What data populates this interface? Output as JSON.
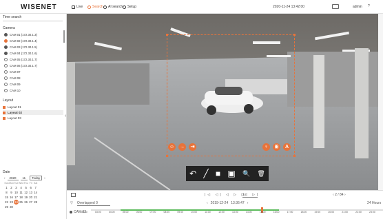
{
  "app": {
    "logo": "WISENET",
    "menu": [
      "Live",
      "Search",
      "AI search",
      "Setup"
    ],
    "datetime": "2020-11-24 13:42:00",
    "user": "admin"
  },
  "sidebar": {
    "search_label": "Time search",
    "camera_label": "Camera",
    "cameras": [
      "CAM 01 (172.30.1.3)",
      "CAM 02 (172.30.1.4)",
      "CAM 03 (172.30.1.5)",
      "CAM 04 (172.30.1.6)",
      "CAM 05 (172.30.1.7)",
      "CAM 06 (172.30.1.7)",
      "CAM 07",
      "CAM 08",
      "CAM 09",
      "CAM 10"
    ],
    "layout_label": "Layout",
    "layouts": [
      "Layout 01",
      "Layout 02",
      "Layout 03"
    ],
    "date_label": "Date",
    "year": "2020",
    "month": "11",
    "today": "Today",
    "weekdays": [
      "Sun",
      "Mon",
      "Tue",
      "Wed",
      "Thu",
      "Fri",
      "Sat"
    ],
    "weeks": [
      [
        "1",
        "2",
        "3",
        "4",
        "5",
        "6",
        "7"
      ],
      [
        "8",
        "9",
        "10",
        "11",
        "12",
        "13",
        "14"
      ],
      [
        "15",
        "16",
        "17",
        "18",
        "19",
        "20",
        "21"
      ],
      [
        "22",
        "23",
        "24",
        "25",
        "26",
        "27",
        "28"
      ],
      [
        "29",
        "30",
        "",
        "",
        "",
        "",
        ""
      ]
    ]
  },
  "overlay": {
    "tools": [
      "↶",
      "╱",
      "■",
      "▣",
      "🔍",
      "🗑"
    ]
  },
  "playback": {
    "filter": "Overlapped 0",
    "date": "2019-12-24",
    "time": "13:36:47",
    "speed": "1x",
    "page": "2",
    "total": "84",
    "range": "24 Hours",
    "cam": "CAM 02",
    "hours": [
      "02:00",
      "03:00",
      "04:00",
      "05:00",
      "06:00",
      "07:00",
      "08:00",
      "09:00",
      "10:00",
      "11:00",
      "12:00",
      "13:00",
      "14:00",
      "15:00",
      "16:00",
      "17:00",
      "18:00",
      "19:00",
      "20:00",
      "21:00",
      "22:00",
      "23:00"
    ]
  }
}
